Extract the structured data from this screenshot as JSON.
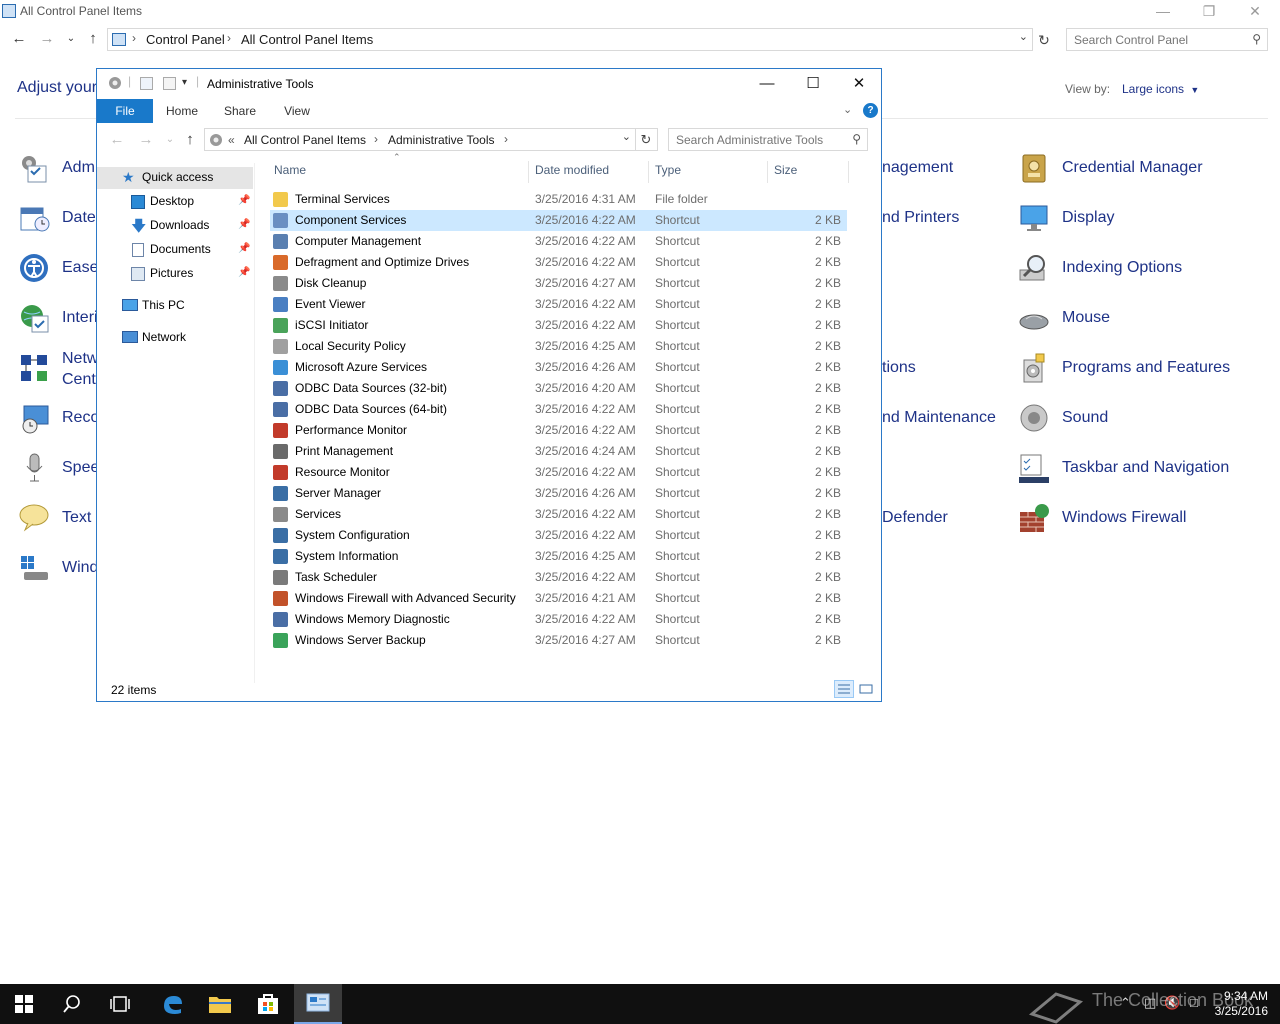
{
  "control_panel": {
    "title": "All Control Panel Items",
    "breadcrumb": [
      "Control Panel",
      "All Control Panel Items"
    ],
    "search_placeholder": "Search Control Panel",
    "heading": "Adjust your",
    "view_by_label": "View by:",
    "view_by_value": "Large icons",
    "left_items": [
      "Adm",
      "Date",
      "Ease",
      "Interi",
      "Netw",
      "Cente",
      "Reco",
      "Spee",
      "Text t",
      "Wind"
    ],
    "middle_items": [
      "nagement",
      "nd Printers",
      "tions",
      "nd Maintenance",
      "Defender"
    ],
    "right_items": [
      "Credential Manager",
      "Display",
      "Indexing Options",
      "Mouse",
      "Programs and Features",
      "Sound",
      "Taskbar and Navigation",
      "Windows Firewall"
    ]
  },
  "explorer": {
    "title": "Administrative Tools",
    "ribbon_tabs": [
      "File",
      "Home",
      "Share",
      "View"
    ],
    "breadcrumb_prefix": "«",
    "breadcrumb": [
      "All Control Panel Items",
      "Administrative Tools"
    ],
    "search_placeholder": "Search Administrative Tools",
    "nav_pane": {
      "quick_access": "Quick access",
      "pinned": [
        "Desktop",
        "Downloads",
        "Documents",
        "Pictures"
      ],
      "this_pc": "This PC",
      "network": "Network"
    },
    "columns": {
      "name": "Name",
      "date": "Date modified",
      "type": "Type",
      "size": "Size"
    },
    "files": [
      {
        "name": "Terminal Services",
        "date": "3/25/2016 4:31 AM",
        "type": "File folder",
        "size": ""
      },
      {
        "name": "Component Services",
        "date": "3/25/2016 4:22 AM",
        "type": "Shortcut",
        "size": "2 KB"
      },
      {
        "name": "Computer Management",
        "date": "3/25/2016 4:22 AM",
        "type": "Shortcut",
        "size": "2 KB"
      },
      {
        "name": "Defragment and Optimize Drives",
        "date": "3/25/2016 4:22 AM",
        "type": "Shortcut",
        "size": "2 KB"
      },
      {
        "name": "Disk Cleanup",
        "date": "3/25/2016 4:27 AM",
        "type": "Shortcut",
        "size": "2 KB"
      },
      {
        "name": "Event Viewer",
        "date": "3/25/2016 4:22 AM",
        "type": "Shortcut",
        "size": "2 KB"
      },
      {
        "name": "iSCSI Initiator",
        "date": "3/25/2016 4:22 AM",
        "type": "Shortcut",
        "size": "2 KB"
      },
      {
        "name": "Local Security Policy",
        "date": "3/25/2016 4:25 AM",
        "type": "Shortcut",
        "size": "2 KB"
      },
      {
        "name": "Microsoft Azure Services",
        "date": "3/25/2016 4:26 AM",
        "type": "Shortcut",
        "size": "2 KB"
      },
      {
        "name": "ODBC Data Sources (32-bit)",
        "date": "3/25/2016 4:20 AM",
        "type": "Shortcut",
        "size": "2 KB"
      },
      {
        "name": "ODBC Data Sources (64-bit)",
        "date": "3/25/2016 4:22 AM",
        "type": "Shortcut",
        "size": "2 KB"
      },
      {
        "name": "Performance Monitor",
        "date": "3/25/2016 4:22 AM",
        "type": "Shortcut",
        "size": "2 KB"
      },
      {
        "name": "Print Management",
        "date": "3/25/2016 4:24 AM",
        "type": "Shortcut",
        "size": "2 KB"
      },
      {
        "name": "Resource Monitor",
        "date": "3/25/2016 4:22 AM",
        "type": "Shortcut",
        "size": "2 KB"
      },
      {
        "name": "Server Manager",
        "date": "3/25/2016 4:26 AM",
        "type": "Shortcut",
        "size": "2 KB"
      },
      {
        "name": "Services",
        "date": "3/25/2016 4:22 AM",
        "type": "Shortcut",
        "size": "2 KB"
      },
      {
        "name": "System Configuration",
        "date": "3/25/2016 4:22 AM",
        "type": "Shortcut",
        "size": "2 KB"
      },
      {
        "name": "System Information",
        "date": "3/25/2016 4:25 AM",
        "type": "Shortcut",
        "size": "2 KB"
      },
      {
        "name": "Task Scheduler",
        "date": "3/25/2016 4:22 AM",
        "type": "Shortcut",
        "size": "2 KB"
      },
      {
        "name": "Windows Firewall with Advanced Security",
        "date": "3/25/2016 4:21 AM",
        "type": "Shortcut",
        "size": "2 KB"
      },
      {
        "name": "Windows Memory Diagnostic",
        "date": "3/25/2016 4:22 AM",
        "type": "Shortcut",
        "size": "2 KB"
      },
      {
        "name": "Windows Server Backup",
        "date": "3/25/2016 4:27 AM",
        "type": "Shortcut",
        "size": "2 KB"
      }
    ],
    "status": "22 items"
  },
  "taskbar": {
    "clock_time": "9:34 AM",
    "clock_date": "3/25/2016",
    "watermark": "The Collection Book"
  }
}
